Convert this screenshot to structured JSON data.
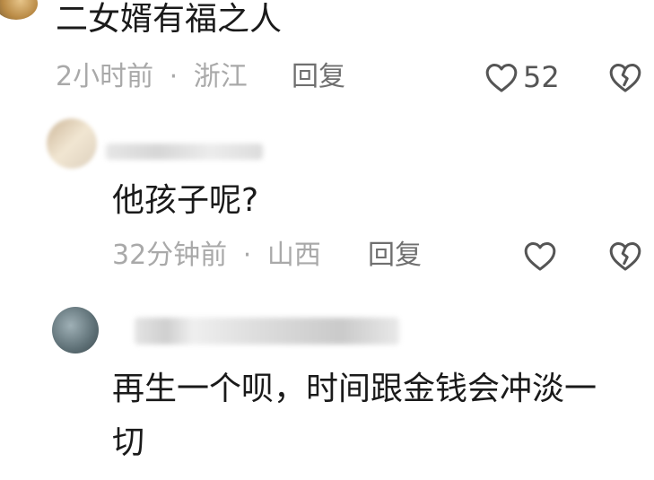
{
  "comments": [
    {
      "text": "二女婿有福之人",
      "time": "2小时前",
      "location": "浙江",
      "reply_label": "回复",
      "like_count": "52"
    },
    {
      "text": "他孩子呢?",
      "time": "32分钟前",
      "location": "山西",
      "reply_label": "回复"
    },
    {
      "text_line1": "再生一个呗，时间跟金钱会冲淡一",
      "text_line2": "切"
    }
  ],
  "separator": "·",
  "icons": {
    "like": "heart-outline-icon",
    "dislike": "broken-heart-icon"
  },
  "colors": {
    "text": "#1a1a1a",
    "meta": "#a9a9a9",
    "reply": "#6f6f6f",
    "icon": "#555555"
  }
}
